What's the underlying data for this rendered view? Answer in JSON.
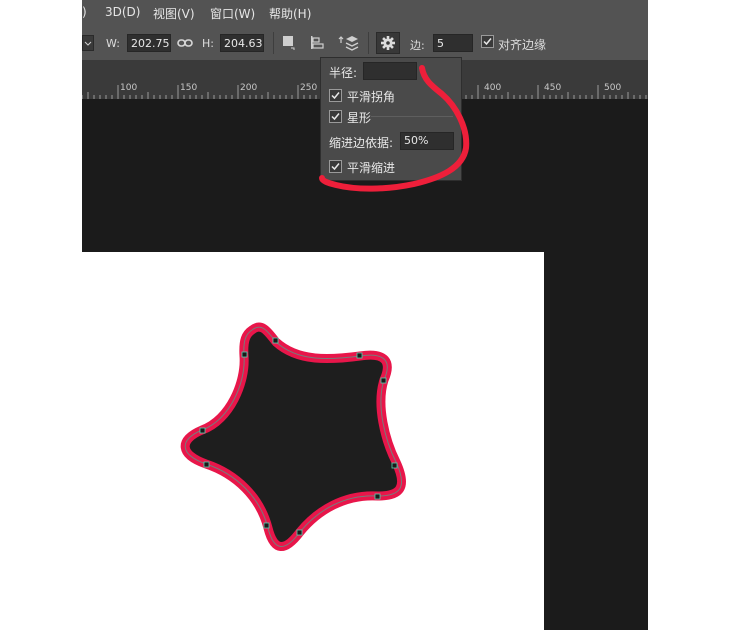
{
  "menu": {
    "items": [
      ")",
      "3D(D)",
      "视图(V)",
      "窗口(W)",
      "帮助(H)"
    ]
  },
  "options": {
    "w_label": "W:",
    "w_value": "202.75",
    "h_label": "H:",
    "h_value": "204.63",
    "sides_label": "边:",
    "sides_value": "5",
    "align_edges_label": "对齐边缘",
    "align_edges_checked": true
  },
  "ruler": {
    "labels": [
      "100",
      "150",
      "200",
      "250",
      "400",
      "450",
      "500"
    ]
  },
  "popup": {
    "radius_label": "半径:",
    "radius_value": "",
    "smooth_corners_label": "平滑拐角",
    "smooth_corners_checked": true,
    "star_label": "星形",
    "star_checked": true,
    "indent_label": "缩进边依据:",
    "indent_value": "50%",
    "smooth_indents_label": "平滑缩进",
    "smooth_indents_checked": true
  },
  "colors": {
    "ui_panel": "#535353",
    "canvas_dark": "#1b1b1b",
    "shape_fill": "#1e1e1e",
    "shape_stroke": "#e8164a",
    "annotation": "#ee1f3a"
  }
}
